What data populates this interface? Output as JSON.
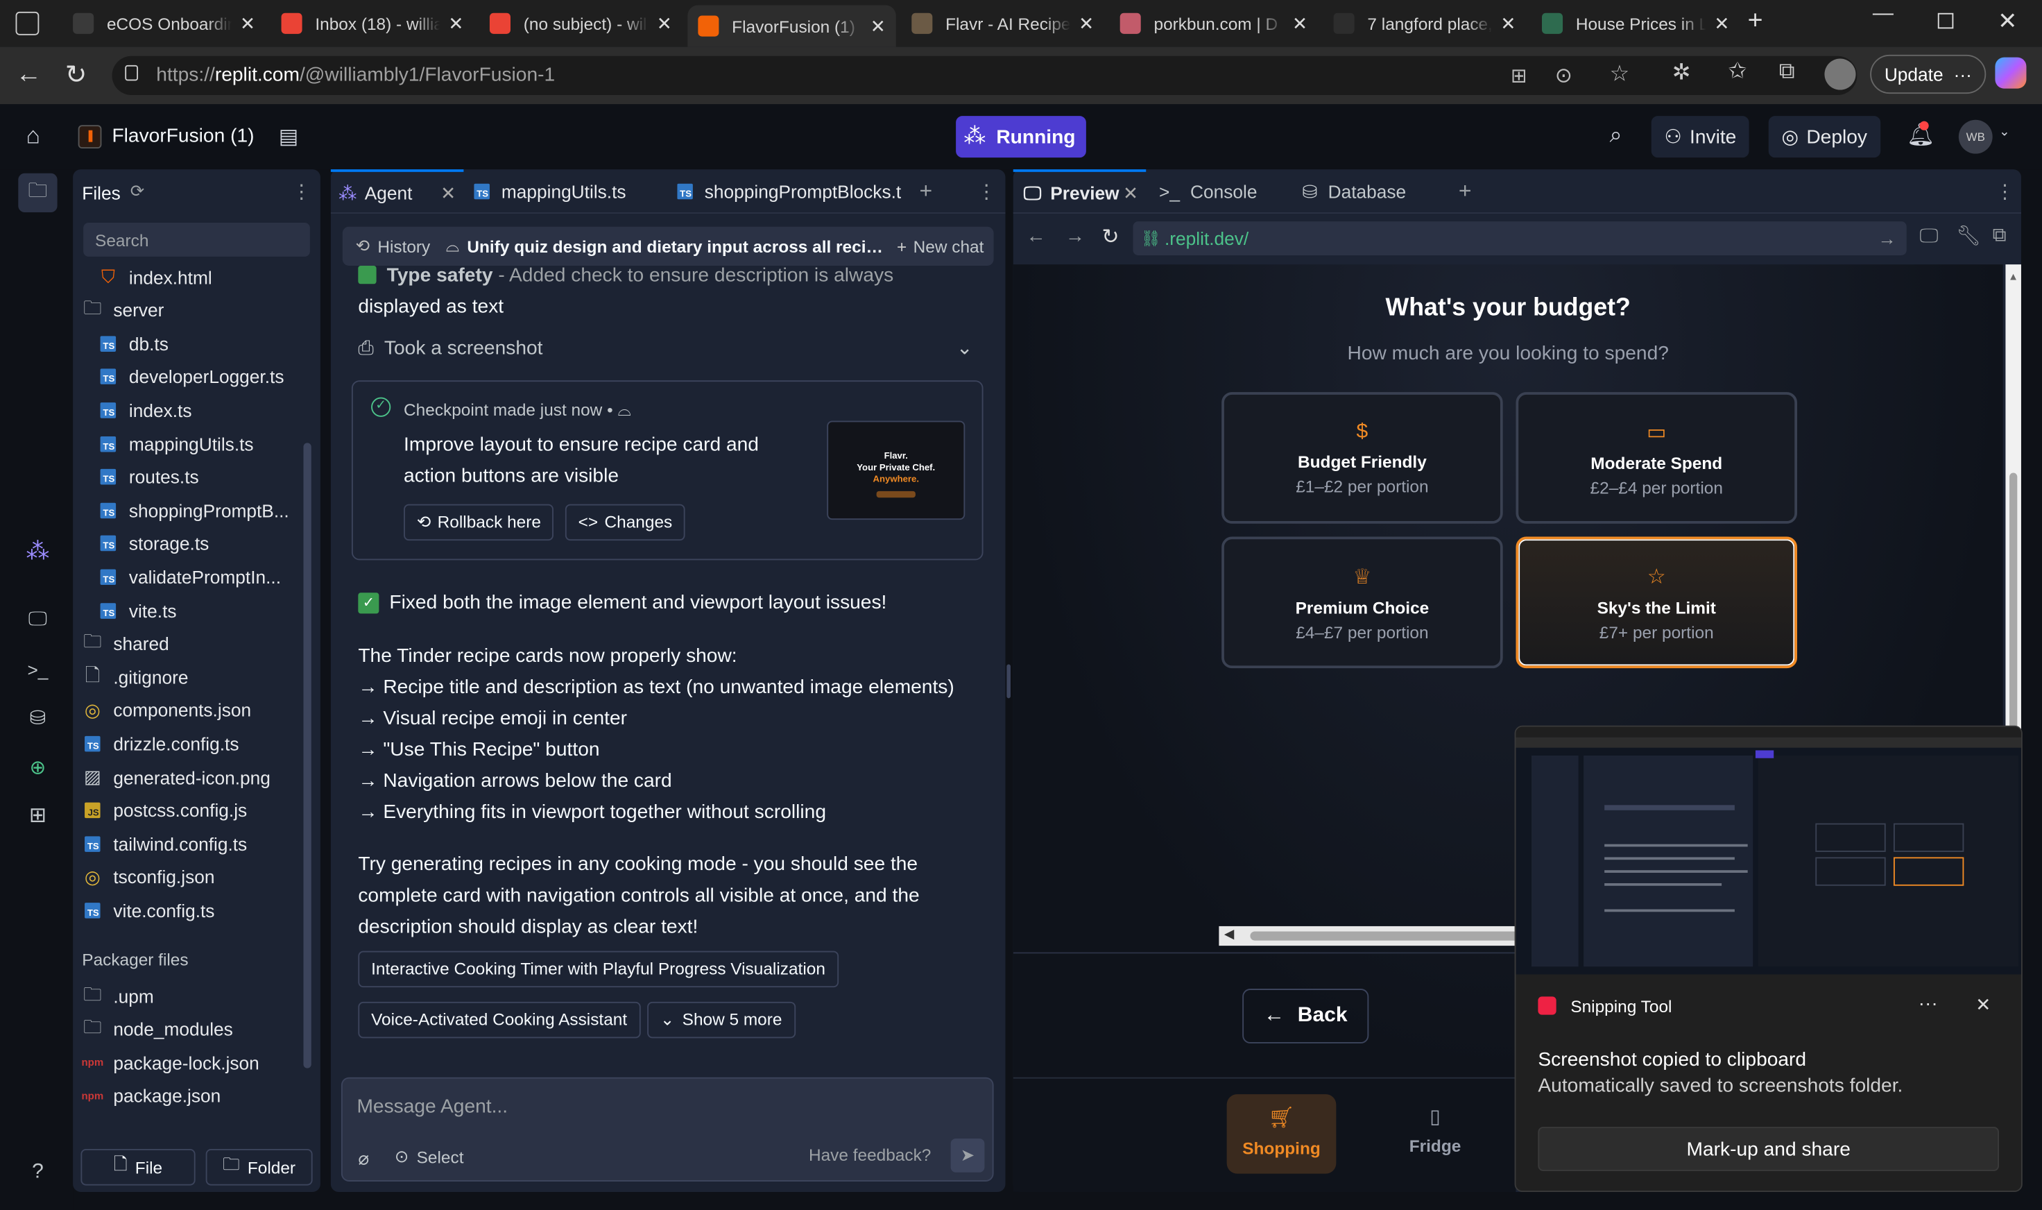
{
  "browser": {
    "tabs": [
      {
        "title": "eCOS Onboardin",
        "icon": "ecos-icon",
        "color": "#3a3a3a"
      },
      {
        "title": "Inbox (18) - willia",
        "icon": "gmail-icon",
        "color": "#ea4335"
      },
      {
        "title": "(no subject) - wil",
        "icon": "gmail-icon",
        "color": "#ea4335"
      },
      {
        "title": "FlavorFusion (1)",
        "icon": "replit-icon",
        "color": "#f26207"
      },
      {
        "title": "Flavr - AI Recipe",
        "icon": "flavr-icon",
        "color": "#6b5a45"
      },
      {
        "title": "porkbun.com | D",
        "icon": "porkbun-icon",
        "color": "#c25b6a"
      },
      {
        "title": "7 langford place,",
        "icon": "search-icon",
        "color": "#2d2d2d"
      },
      {
        "title": "House Prices in L",
        "icon": "house-icon",
        "color": "#2e6b4f"
      }
    ],
    "url_prefix": "https://",
    "url_host": "replit.com",
    "url_path": "/@williambly1/FlavorFusion-1",
    "update_label": "Update"
  },
  "replit": {
    "project_name": "FlavorFusion (1)",
    "run_label": "Running",
    "invite_label": "Invite",
    "deploy_label": "Deploy",
    "avatar_initials": "WB"
  },
  "files": {
    "title": "Files",
    "search_placeholder": "Search",
    "items": [
      {
        "name": "index.html",
        "type": "html",
        "indent": 1
      },
      {
        "name": "server",
        "type": "folder",
        "indent": 0
      },
      {
        "name": "db.ts",
        "type": "ts",
        "indent": 1
      },
      {
        "name": "developerLogger.ts",
        "type": "ts",
        "indent": 1
      },
      {
        "name": "index.ts",
        "type": "ts",
        "indent": 1
      },
      {
        "name": "mappingUtils.ts",
        "type": "ts",
        "indent": 1
      },
      {
        "name": "routes.ts",
        "type": "ts",
        "indent": 1
      },
      {
        "name": "shoppingPromptB...",
        "type": "ts",
        "indent": 1
      },
      {
        "name": "storage.ts",
        "type": "ts",
        "indent": 1
      },
      {
        "name": "validatePromptIn...",
        "type": "ts",
        "indent": 1
      },
      {
        "name": "vite.ts",
        "type": "ts",
        "indent": 1
      },
      {
        "name": "shared",
        "type": "folder",
        "indent": 0
      },
      {
        "name": ".gitignore",
        "type": "file",
        "indent": 0
      },
      {
        "name": "components.json",
        "type": "json",
        "indent": 0
      },
      {
        "name": "drizzle.config.ts",
        "type": "ts",
        "indent": 0
      },
      {
        "name": "generated-icon.png",
        "type": "image",
        "indent": 0
      },
      {
        "name": "postcss.config.js",
        "type": "js",
        "indent": 0
      },
      {
        "name": "tailwind.config.ts",
        "type": "ts",
        "indent": 0
      },
      {
        "name": "tsconfig.json",
        "type": "json",
        "indent": 0
      },
      {
        "name": "vite.config.ts",
        "type": "ts",
        "indent": 0
      }
    ],
    "packager_title": "Packager files",
    "packager_items": [
      {
        "name": ".upm",
        "type": "folder"
      },
      {
        "name": "node_modules",
        "type": "folder"
      },
      {
        "name": "package-lock.json",
        "type": "npm"
      },
      {
        "name": "package.json",
        "type": "npm"
      }
    ],
    "file_button": "File",
    "folder_button": "Folder"
  },
  "editor_tabs": [
    {
      "label": "Agent"
    },
    {
      "label": "mappingUtils.ts"
    },
    {
      "label": "shoppingPromptBlocks.t"
    }
  ],
  "agent": {
    "history_label": "History",
    "thread_title": "Unify quiz design and dietary input across all recip...",
    "new_chat_label": "New chat",
    "prev_line_bold": "Type safety",
    "prev_line_rest": " - Added check to ensure description is always",
    "prev_line_2": "displayed as text",
    "screenshot_label": "Took a screenshot",
    "checkpoint_label": "Checkpoint made just now",
    "checkpoint_text": "Improve layout to ensure recipe card and action buttons are visible",
    "rollback_label": "Rollback here",
    "changes_label": "Changes",
    "thumb_title": "Flavr.",
    "thumb_line1": "Your Private Chef.",
    "thumb_line2": "Anywhere.",
    "fixed_line": "Fixed both the image element and viewport layout issues!",
    "cards_intro": "The Tinder recipe cards now properly show:",
    "bullets": [
      "→ Recipe title and description as text (no unwanted image elements)",
      "→ Visual recipe emoji in center",
      "→ \"Use This Recipe\" button",
      "→ Navigation arrows below the card",
      "→ Everything fits in viewport together without scrolling"
    ],
    "closing": "Try generating recipes in any cooking mode - you should see the complete card with navigation controls all visible at once, and the description should display as clear text!",
    "suggestion_1": "Interactive Cooking Timer with Playful Progress Visualization",
    "suggestion_2": "Voice-Activated Cooking Assistant",
    "show_more_label": "Show 5 more",
    "message_placeholder": "Message Agent...",
    "select_label": "Select",
    "feedback_label": "Have feedback?"
  },
  "preview_tabs": [
    {
      "label": "Preview"
    },
    {
      "label": "Console"
    },
    {
      "label": "Database"
    }
  ],
  "preview": {
    "url": ".replit.dev/",
    "heading": "What's your budget?",
    "subheading": "How much are you looking to spend?",
    "options": [
      {
        "label": "Budget Friendly",
        "sub": "£1–£2 per portion",
        "icon": "dollar-icon",
        "selected": false
      },
      {
        "label": "Moderate Spend",
        "sub": "£2–£4 per portion",
        "icon": "card-icon",
        "selected": false
      },
      {
        "label": "Premium Choice",
        "sub": "£4–£7 per portion",
        "icon": "crown-icon",
        "selected": false
      },
      {
        "label": "Sky's the Limit",
        "sub": "£7+ per portion",
        "icon": "star-icon",
        "selected": true
      }
    ],
    "back_label": "Back",
    "nav": [
      {
        "label": "Shopping",
        "icon": "cart-icon",
        "active": true
      },
      {
        "label": "Fridge",
        "icon": "fridge-icon",
        "active": false
      }
    ],
    "accent": "#f08a24"
  },
  "snipping": {
    "app_name": "Snipping Tool",
    "message_title": "Screenshot copied to clipboard",
    "message_body": "Automatically saved to screenshots folder.",
    "action_label": "Mark-up and share"
  }
}
